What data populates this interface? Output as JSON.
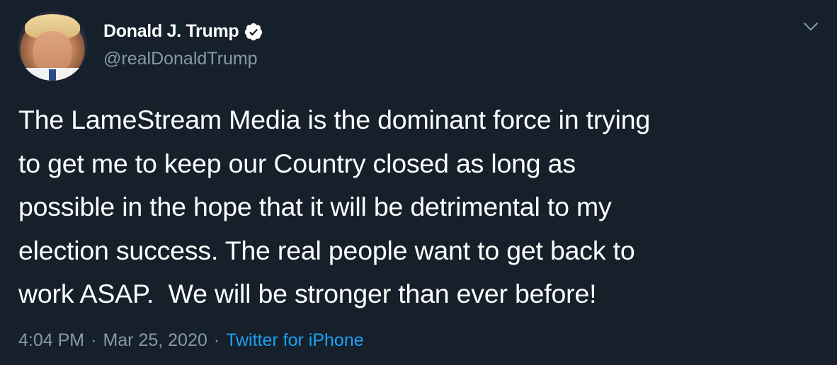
{
  "user": {
    "display_name": "Donald J. Trump",
    "handle": "@realDonaldTrump",
    "verified": true,
    "verified_icon": "verified-badge-icon"
  },
  "tweet": {
    "text": "The LameStream Media is the dominant force in trying\nto get me to keep our Country closed as long as\npossible in the hope that it will be detrimental to my\nelection success. The real people want to get back to\nwork ASAP.  We will be stronger than ever before!",
    "time": "4:04 PM",
    "separator": "·",
    "date": "Mar 25, 2020",
    "source": "Twitter for iPhone"
  },
  "colors": {
    "background": "#15202b",
    "text_primary": "#ffffff",
    "text_secondary": "#8899a6",
    "link": "#1da1f2"
  },
  "icons": {
    "menu": "chevron-down-icon"
  }
}
